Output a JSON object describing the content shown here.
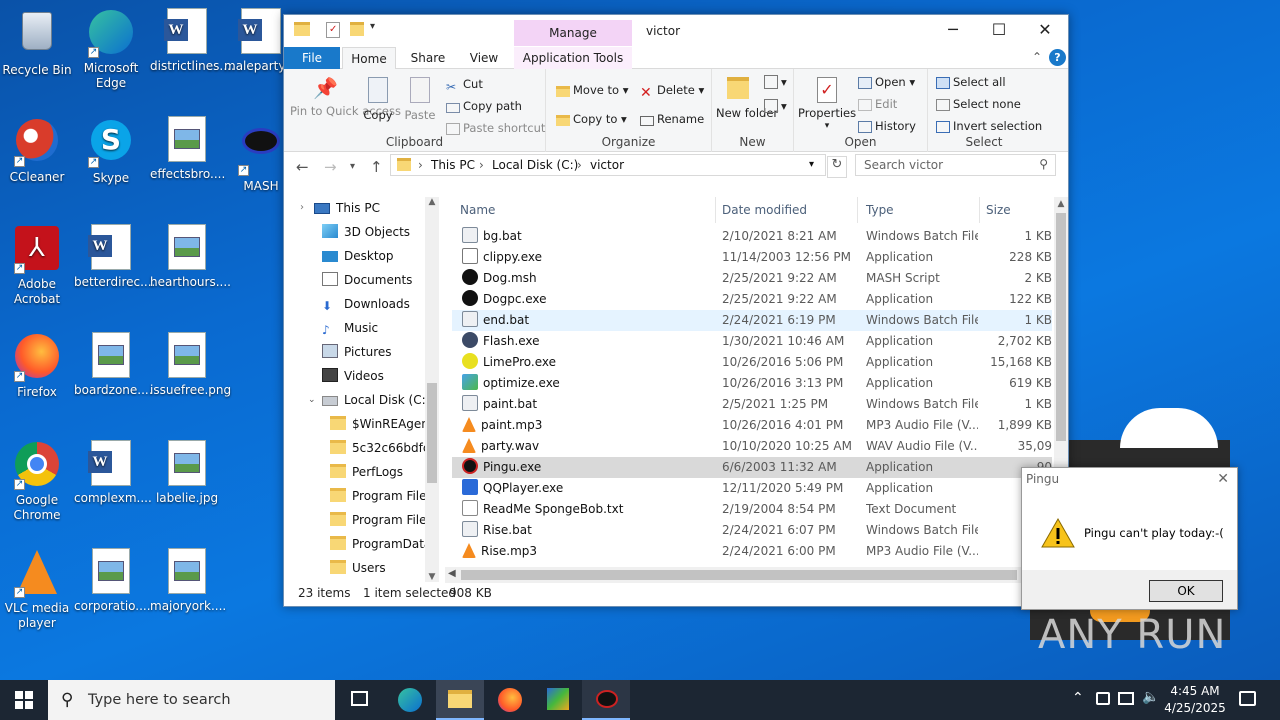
{
  "desktop": {
    "icons": [
      {
        "label": "Recycle Bin",
        "icon": "recycle-bin-icon"
      },
      {
        "label": "Microsoft Edge",
        "icon": "edge-icon"
      },
      {
        "label": "districtlines....",
        "icon": "word-doc-icon"
      },
      {
        "label": "maleparty....",
        "icon": "word-doc-icon"
      },
      {
        "label": "CCleaner",
        "icon": "ccleaner-icon"
      },
      {
        "label": "Skype",
        "icon": "skype-icon"
      },
      {
        "label": "effectsbro....",
        "icon": "image-file-icon"
      },
      {
        "label": "MASH",
        "icon": "mash-icon"
      },
      {
        "label": "Adobe Acrobat",
        "icon": "acrobat-icon"
      },
      {
        "label": "betterdirec....",
        "icon": "word-doc-icon"
      },
      {
        "label": "hearthours....",
        "icon": "image-file-icon"
      },
      {
        "label": "Firefox",
        "icon": "firefox-icon"
      },
      {
        "label": "boardzone....",
        "icon": "image-file-icon"
      },
      {
        "label": "issuefree.png",
        "icon": "image-file-icon"
      },
      {
        "label": "Google Chrome",
        "icon": "chrome-icon"
      },
      {
        "label": "complexm....",
        "icon": "word-doc-icon"
      },
      {
        "label": "labelie.jpg",
        "icon": "image-file-icon"
      },
      {
        "label": "VLC media player",
        "icon": "vlc-icon"
      },
      {
        "label": "corporatio....",
        "icon": "image-file-icon"
      },
      {
        "label": "majoryork....",
        "icon": "image-file-icon"
      }
    ]
  },
  "explorer": {
    "title": "victor",
    "manage_tab": "Manage",
    "tabs": {
      "file": "File",
      "home": "Home",
      "share": "Share",
      "view": "View",
      "app_tools": "Application Tools"
    },
    "ribbon": {
      "clipboard": {
        "group": "Clipboard",
        "pin": "Pin to Quick access",
        "copy": "Copy",
        "paste": "Paste",
        "cut": "Cut",
        "copy_path": "Copy path",
        "paste_shortcut": "Paste shortcut"
      },
      "organize": {
        "group": "Organize",
        "move_to": "Move to",
        "copy_to": "Copy to",
        "delete": "Delete",
        "rename": "Rename"
      },
      "new": {
        "group": "New",
        "new_folder": "New folder"
      },
      "open": {
        "group": "Open",
        "properties": "Properties",
        "open": "Open",
        "edit": "Edit",
        "history": "History"
      },
      "select": {
        "group": "Select",
        "select_all": "Select all",
        "select_none": "Select none",
        "invert": "Invert selection"
      }
    },
    "address": {
      "crumbs": [
        "This PC",
        "Local Disk (C:)",
        "victor"
      ]
    },
    "search_placeholder": "Search victor",
    "tree": [
      "This PC",
      "3D Objects",
      "Desktop",
      "Documents",
      "Downloads",
      "Music",
      "Pictures",
      "Videos",
      "Local Disk (C:)",
      "$WinREAgent",
      "5c32c66bdfc4",
      "PerfLogs",
      "Program Files",
      "Program Files",
      "ProgramData",
      "Users"
    ],
    "columns": {
      "name": "Name",
      "date": "Date modified",
      "type": "Type",
      "size": "Size"
    },
    "files": [
      {
        "name": "bg.bat",
        "date": "2/10/2021 8:21 AM",
        "type": "Windows Batch File",
        "size": "1 KB"
      },
      {
        "name": "clippy.exe",
        "date": "11/14/2003 12:56 PM",
        "type": "Application",
        "size": "228 KB"
      },
      {
        "name": "Dog.msh",
        "date": "2/25/2021 9:22 AM",
        "type": "MASH Script",
        "size": "2 KB"
      },
      {
        "name": "Dogpc.exe",
        "date": "2/25/2021 9:22 AM",
        "type": "Application",
        "size": "122 KB"
      },
      {
        "name": "end.bat",
        "date": "2/24/2021 6:19 PM",
        "type": "Windows Batch File",
        "size": "1 KB"
      },
      {
        "name": "Flash.exe",
        "date": "1/30/2021 10:46 AM",
        "type": "Application",
        "size": "2,702 KB"
      },
      {
        "name": "LimePro.exe",
        "date": "10/26/2016 5:06 PM",
        "type": "Application",
        "size": "15,168 KB"
      },
      {
        "name": "optimize.exe",
        "date": "10/26/2016 3:13 PM",
        "type": "Application",
        "size": "619 KB"
      },
      {
        "name": "paint.bat",
        "date": "2/5/2021 1:25 PM",
        "type": "Windows Batch File",
        "size": "1 KB"
      },
      {
        "name": "paint.mp3",
        "date": "10/26/2016 4:01 PM",
        "type": "MP3 Audio File (V...",
        "size": "1,899 KB"
      },
      {
        "name": "party.wav",
        "date": "10/10/2020 10:25 AM",
        "type": "WAV Audio File (V...",
        "size": "35,09"
      },
      {
        "name": "Pingu.exe",
        "date": "6/6/2003 11:32 AM",
        "type": "Application",
        "size": "90"
      },
      {
        "name": "QQPlayer.exe",
        "date": "12/11/2020 5:49 PM",
        "type": "Application",
        "size": "34,8"
      },
      {
        "name": "ReadMe SpongeBob.txt",
        "date": "2/19/2004 8:54 PM",
        "type": "Text Document",
        "size": ""
      },
      {
        "name": "Rise.bat",
        "date": "2/24/2021 6:07 PM",
        "type": "Windows Batch File",
        "size": ""
      },
      {
        "name": "Rise.mp3",
        "date": "2/24/2021 6:00 PM",
        "type": "MP3 Audio File (V...",
        "size": "3,5"
      }
    ],
    "status": {
      "items": "23 items",
      "selected": "1 item selected",
      "size": "908 KB"
    }
  },
  "dialog": {
    "title": "Pingu",
    "message": "Pingu can't play today:-(",
    "ok": "OK"
  },
  "taskbar": {
    "search_placeholder": "Type here to search",
    "time": "4:45 AM",
    "date": "4/25/2025"
  },
  "watermark": "ANY RUN"
}
